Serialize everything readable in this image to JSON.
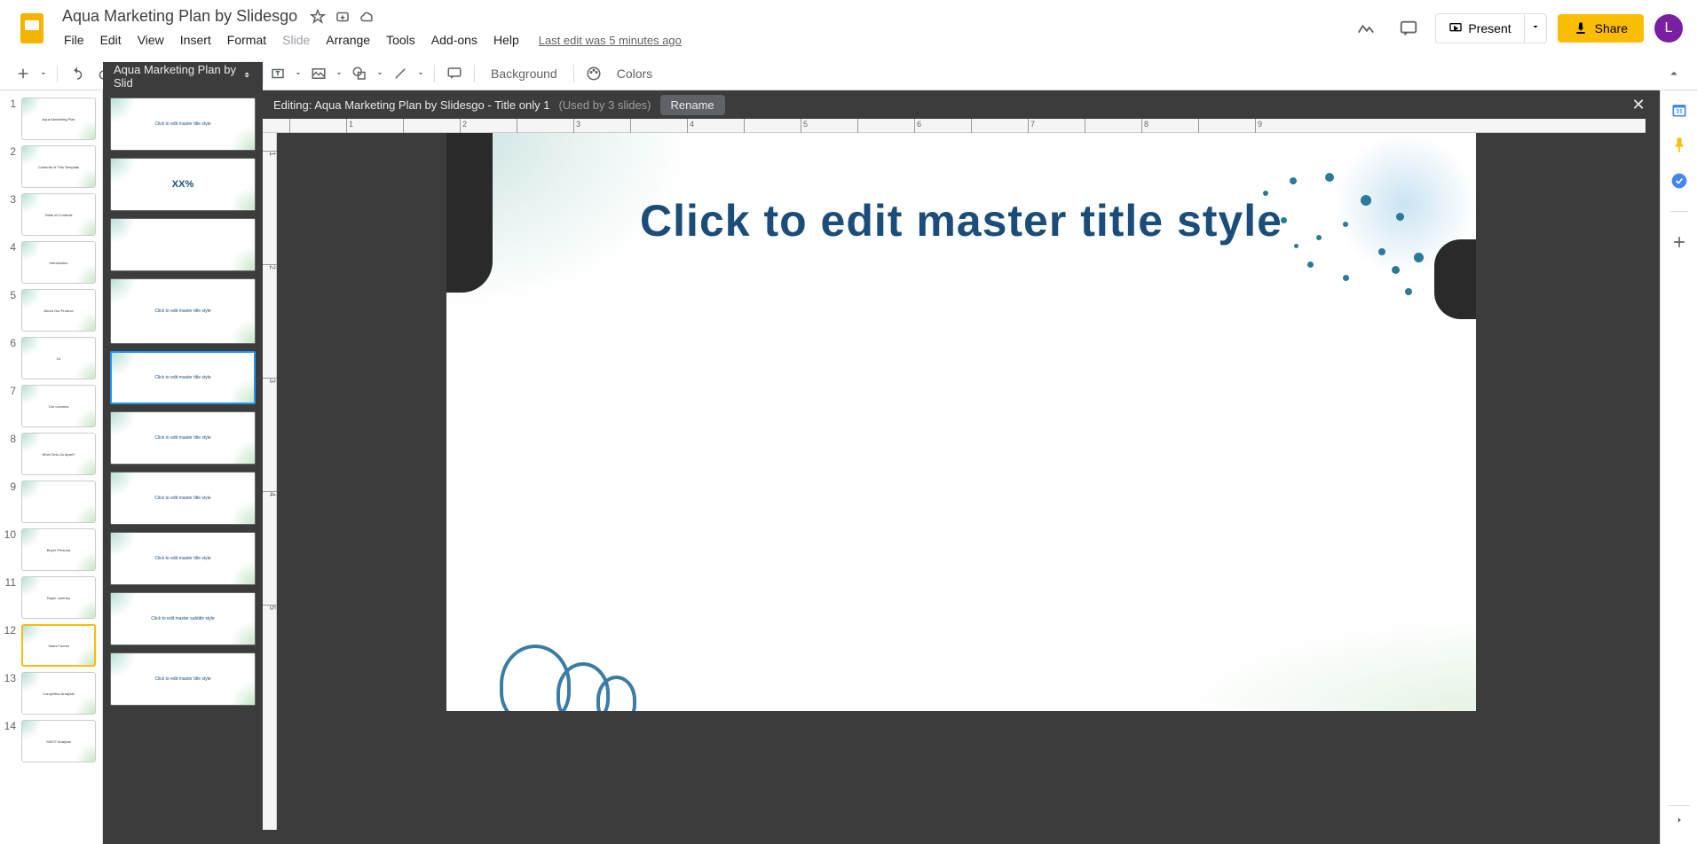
{
  "header": {
    "doc_title": "Aqua Marketing Plan by Slidesgo",
    "menu": {
      "file": "File",
      "edit": "Edit",
      "view": "View",
      "insert": "Insert",
      "format": "Format",
      "slide": "Slide",
      "arrange": "Arrange",
      "tools": "Tools",
      "addons": "Add-ons",
      "help": "Help"
    },
    "last_edit": "Last edit was 5 minutes ago",
    "present_label": "Present",
    "share_label": "Share",
    "avatar_letter": "L"
  },
  "toolbar": {
    "background_label": "Background",
    "colors_label": "Colors"
  },
  "master_editor": {
    "dropdown_label": "Aqua Marketing Plan by Slid",
    "editing_label": "Editing: Aqua Marketing Plan by Slidesgo - Title only 1",
    "used_by": "(Used by 3 slides)",
    "rename_label": "Rename"
  },
  "canvas": {
    "title_placeholder": "Click to edit master title style",
    "ruler_marks": [
      "",
      "1",
      "",
      "2",
      "",
      "3",
      "",
      "4",
      "",
      "5",
      "",
      "6",
      "",
      "7",
      "",
      "8",
      "",
      "9"
    ],
    "ruler_v_marks": [
      "1",
      "2",
      "3",
      "4",
      "5"
    ]
  },
  "slide_panel": {
    "slides": [
      {
        "num": "1",
        "label": "Aqua Marketing Plan"
      },
      {
        "num": "2",
        "label": "Contents of This Template"
      },
      {
        "num": "3",
        "label": "Table of Contents"
      },
      {
        "num": "4",
        "label": "Introduction"
      },
      {
        "num": "5",
        "label": "About Our Product"
      },
      {
        "num": "6",
        "label": "01"
      },
      {
        "num": "7",
        "label": "Our columns"
      },
      {
        "num": "8",
        "label": "What Sets Us Apart?"
      },
      {
        "num": "9",
        "label": ""
      },
      {
        "num": "10",
        "label": "Buyer Persona"
      },
      {
        "num": "11",
        "label": "Buyer Journey"
      },
      {
        "num": "12",
        "label": "Sales Funnel"
      },
      {
        "num": "13",
        "label": "Competitor Analysis"
      },
      {
        "num": "14",
        "label": "SWOT Analysis"
      }
    ]
  },
  "master_panel": {
    "thumbs": [
      {
        "label": "Click to edit master title style"
      },
      {
        "label": "XX%"
      },
      {
        "label": ""
      },
      {
        "label": "Click to edit master title style"
      },
      {
        "label": "Click to edit master title style",
        "selected": true
      },
      {
        "label": "Click to edit master title style"
      },
      {
        "label": "Click to edit master title style"
      },
      {
        "label": "Click to edit master title style"
      },
      {
        "label": "Click to edit master subtitle style"
      },
      {
        "label": "Click to edit master title style"
      }
    ]
  }
}
